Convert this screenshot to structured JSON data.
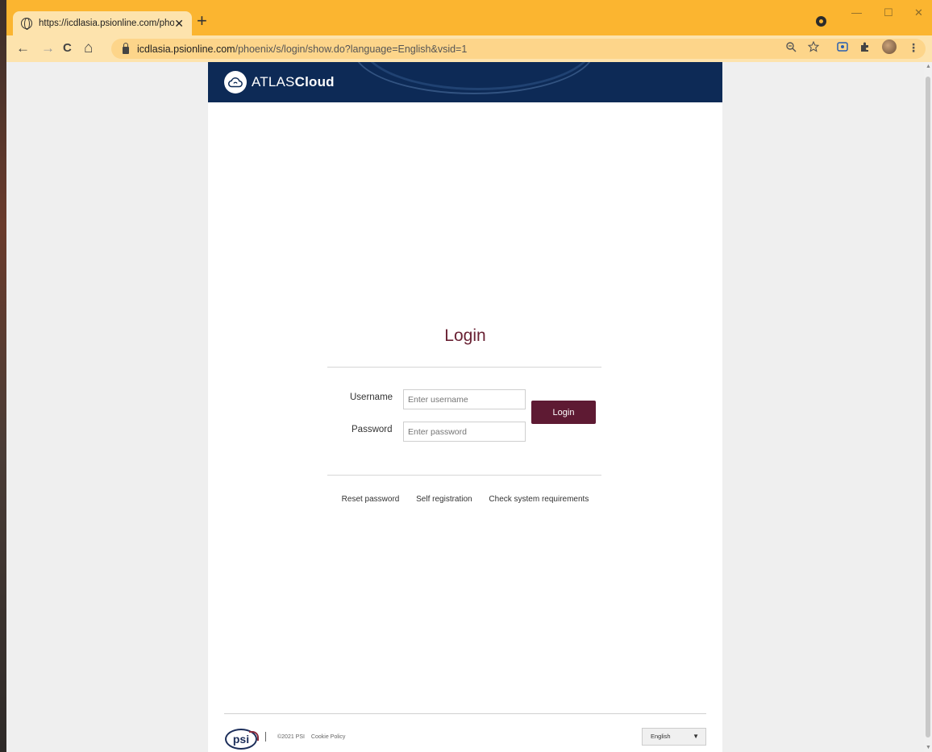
{
  "browser": {
    "tab_title": "https://icdlasia.psionline.com/phoenix/s/login/show.do",
    "tab_close": "✕",
    "new_tab": "+",
    "url_host": "icdlasia.psionline.com",
    "url_path": "/phoenix/s/login/show.do?language=English&vsid=1",
    "nav": {
      "back": "←",
      "forward": "→",
      "reload": "C",
      "home": "⌂"
    },
    "window_controls": {
      "minimize": "—",
      "maximize": "☐",
      "close": "✕"
    },
    "icons": [
      "zoom-icon",
      "star-icon",
      "screen-record-icon",
      "puzzle-icon",
      "profile-avatar",
      "menu-kebab-icon"
    ]
  },
  "header": {
    "brand_light": "ATLAS",
    "brand_bold": "Cloud",
    "bg_color": "#0d2a56"
  },
  "login": {
    "title": "Login",
    "username_label": "Username",
    "username_placeholder": "Enter username",
    "password_label": "Password",
    "password_placeholder": "Enter password",
    "button_label": "Login",
    "accent_color": "#5e1a33"
  },
  "links": {
    "reset": "Reset password",
    "register": "Self registration",
    "requirements": "Check system requirements"
  },
  "footer": {
    "psi_logo": "psi",
    "copyright": "©2021 PSI",
    "cookie": "Cookie Policy",
    "language_selected": "English"
  }
}
